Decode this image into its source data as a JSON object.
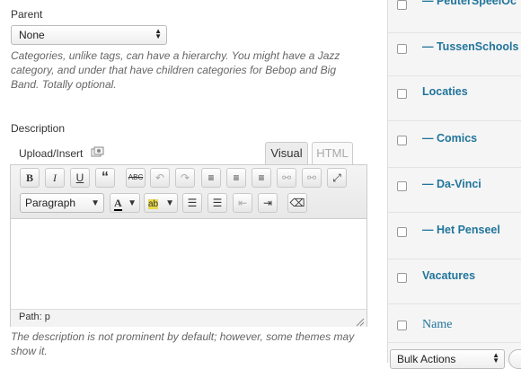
{
  "parent": {
    "label": "Parent",
    "value": "None",
    "help": "Categories, unlike tags, can have a hierarchy. You might have a Jazz category, and under that have children categories for Bebop and Big Band. Totally optional."
  },
  "description": {
    "label": "Description",
    "upload_label": "Upload/Insert",
    "tabs": [
      "Visual",
      "HTML"
    ],
    "format_value": "Paragraph",
    "path_label": "Path: p",
    "help": "The description is not prominent by default; however, some themes may show it."
  },
  "toolbar": {
    "row1": [
      "B",
      "I",
      "U",
      "“",
      "ABC",
      "↶",
      "↷",
      "≡",
      "≡",
      "≡",
      "⚯",
      "⚯",
      "⤢"
    ],
    "row2": [
      "A",
      "ab",
      "☰",
      "☰",
      "⇤",
      "⇥",
      "⌫"
    ]
  },
  "categories": {
    "items": [
      "— PeuterSpeelOc",
      "— TussenSchools",
      "Locaties",
      "— Comics",
      "— Da-Vinci",
      "— Het Penseel",
      "Vacatures"
    ],
    "column_header": "Name",
    "bulk_actions": "Bulk Actions"
  }
}
